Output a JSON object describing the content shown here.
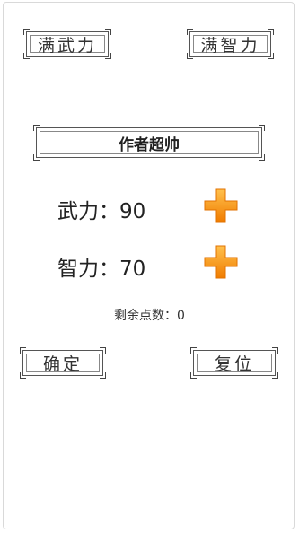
{
  "buttons": {
    "max_force": "满武力",
    "max_intel": "满智力",
    "confirm": "确定",
    "reset": "复位"
  },
  "title": "作者超帅",
  "stats": {
    "force": {
      "label": "武力：",
      "value": "90"
    },
    "intel": {
      "label": "智力：",
      "value": "70"
    }
  },
  "remaining": {
    "label": "剩余点数：",
    "value": "0"
  },
  "icons": {
    "plus": "plus-icon"
  },
  "colors": {
    "plus_light": "#ffc14d",
    "plus_dark": "#f07c00"
  }
}
